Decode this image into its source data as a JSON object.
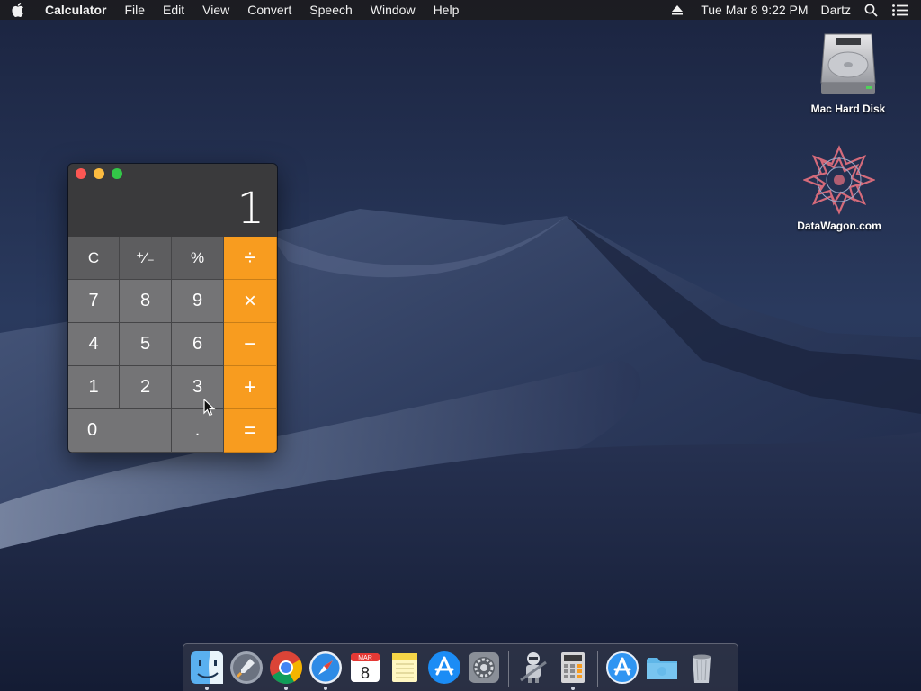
{
  "menubar": {
    "app_name": "Calculator",
    "menus": [
      "File",
      "Edit",
      "View",
      "Convert",
      "Speech",
      "Window",
      "Help"
    ],
    "clock": "Tue Mar 8  9:22 PM",
    "user": "Dartz"
  },
  "desktop": {
    "icons": [
      {
        "label": "Mac Hard Disk",
        "icon": "hard-disk-icon"
      },
      {
        "label": "DataWagon.com",
        "icon": "wolfram-star-icon"
      }
    ]
  },
  "calculator": {
    "display": "1",
    "keys": {
      "clear": "C",
      "sign": "⁺∕₋",
      "percent": "%",
      "divide": "÷",
      "seven": "7",
      "eight": "8",
      "nine": "9",
      "multiply": "×",
      "four": "4",
      "five": "5",
      "six": "6",
      "minus": "−",
      "one": "1",
      "two": "2",
      "three": "3",
      "plus": "+",
      "zero": "0",
      "decimal": ".",
      "equals": "="
    }
  },
  "dock": {
    "calendar_month": "MAR",
    "calendar_day": "8",
    "items": [
      "finder-icon",
      "launchpad-icon",
      "chrome-icon",
      "safari-icon",
      "calendar-icon",
      "notes-icon",
      "app-store-icon",
      "system-preferences-icon",
      "automator-icon",
      "calculator-icon",
      "app-store-folder-icon",
      "folder-icon",
      "trash-icon"
    ]
  },
  "colors": {
    "operator_key": "#f89c1f",
    "function_key": "#5d5d5f",
    "number_key": "#747476"
  }
}
